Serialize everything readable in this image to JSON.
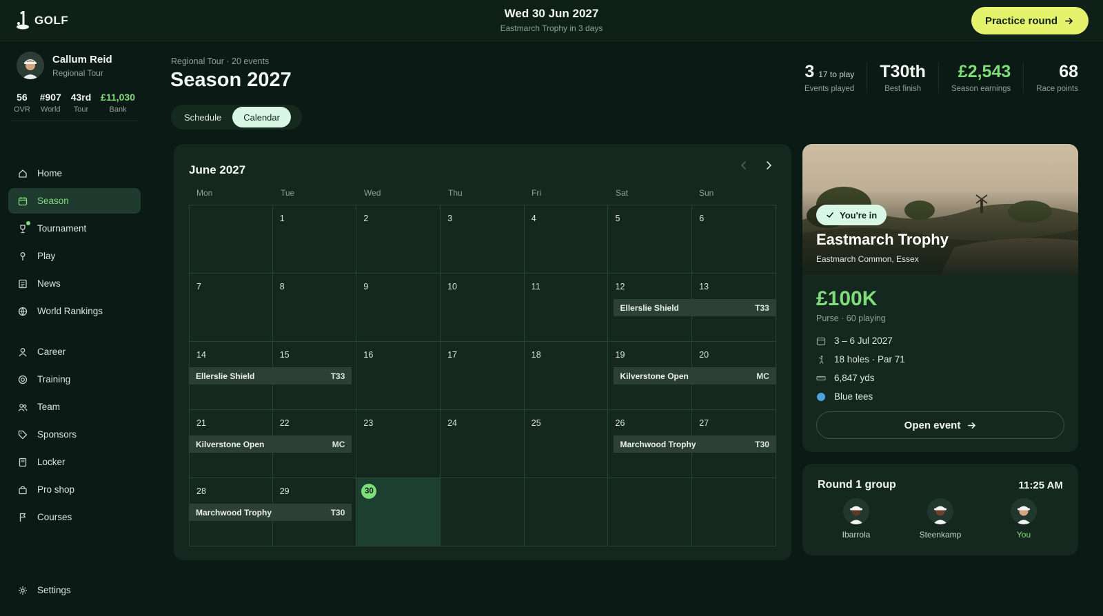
{
  "app": {
    "logo_text": "GOLF"
  },
  "header": {
    "date": "Wed 30 Jun 2027",
    "subtitle": "Eastmarch Trophy in 3 days",
    "practice_label": "Practice round"
  },
  "profile": {
    "name": "Callum Reid",
    "tour": "Regional Tour",
    "stats": [
      {
        "value": "56",
        "label": "OVR"
      },
      {
        "value": "#907",
        "label": "World"
      },
      {
        "value": "43rd",
        "label": "Tour"
      },
      {
        "value": "£11,030",
        "label": "Bank"
      }
    ]
  },
  "nav": {
    "items": [
      {
        "label": "Home",
        "icon": "home-icon"
      },
      {
        "label": "Season",
        "icon": "calendar-icon"
      },
      {
        "label": "Tournament",
        "icon": "trophy-icon"
      },
      {
        "label": "Play",
        "icon": "pin-icon"
      },
      {
        "label": "News",
        "icon": "news-icon"
      },
      {
        "label": "World Rankings",
        "icon": "globe-icon"
      },
      {
        "label": "Career",
        "icon": "user-icon"
      },
      {
        "label": "Training",
        "icon": "target-icon"
      },
      {
        "label": "Team",
        "icon": "team-icon"
      },
      {
        "label": "Sponsors",
        "icon": "tag-icon"
      },
      {
        "label": "Locker",
        "icon": "locker-icon"
      },
      {
        "label": "Pro shop",
        "icon": "bag-icon"
      },
      {
        "label": "Courses",
        "icon": "flag-icon"
      }
    ],
    "settings_label": "Settings"
  },
  "page": {
    "breadcrumb": "Regional Tour · 20 events",
    "title": "Season 2027",
    "tabs": [
      "Schedule",
      "Calendar"
    ],
    "active_tab": "Calendar",
    "stats": [
      {
        "value": "3",
        "extra": "17 to play",
        "label": "Events played"
      },
      {
        "value": "T30th",
        "extra": "",
        "label": "Best finish"
      },
      {
        "value": "£2,543",
        "extra": "",
        "label": "Season earnings"
      },
      {
        "value": "68",
        "extra": "",
        "label": "Race points"
      }
    ]
  },
  "calendar": {
    "month_label": "June 2027",
    "weekdays": [
      "Mon",
      "Tue",
      "Wed",
      "Thu",
      "Fri",
      "Sat",
      "Sun"
    ],
    "weeks": [
      [
        "",
        "1",
        "2",
        "3",
        "4",
        "5",
        "6"
      ],
      [
        "7",
        "8",
        "9",
        "10",
        "11",
        "12",
        "13"
      ],
      [
        "14",
        "15",
        "16",
        "17",
        "18",
        "19",
        "20"
      ],
      [
        "21",
        "22",
        "23",
        "24",
        "25",
        "26",
        "27"
      ],
      [
        "28",
        "29",
        "30",
        "",
        "",
        "",
        ""
      ]
    ],
    "today": "30",
    "events": [
      {
        "name": "Ellerslie Shield",
        "result": "T33"
      },
      {
        "name": "Ellerslie Shield",
        "result": "T33"
      },
      {
        "name": "Kilverstone Open",
        "result": "MC"
      },
      {
        "name": "Kilverstone Open",
        "result": "MC"
      },
      {
        "name": "Marchwood Trophy",
        "result": "T30"
      },
      {
        "name": "Marchwood Trophy",
        "result": "T30"
      }
    ]
  },
  "event": {
    "badge": "You're in",
    "name": "Eastmarch Trophy",
    "location": "Eastmarch Common, Essex",
    "purse": "£100K",
    "purse_sub": "Purse · 60 playing",
    "dates": "3 – 6 Jul 2027",
    "holes": "18 holes · Par 71",
    "yardage": "6,847 yds",
    "tees": "Blue tees",
    "tee_color": "#4aa3df",
    "open_label": "Open event"
  },
  "round": {
    "title": "Round 1 group",
    "time": "11:25 AM",
    "players": [
      {
        "name": "Ibarrola"
      },
      {
        "name": "Steenkamp"
      },
      {
        "name": "You"
      }
    ]
  },
  "colors": {
    "accent": "#7fdc7a",
    "cta": "#e5f26b",
    "background": "#0c1a16",
    "card": "#142820"
  }
}
